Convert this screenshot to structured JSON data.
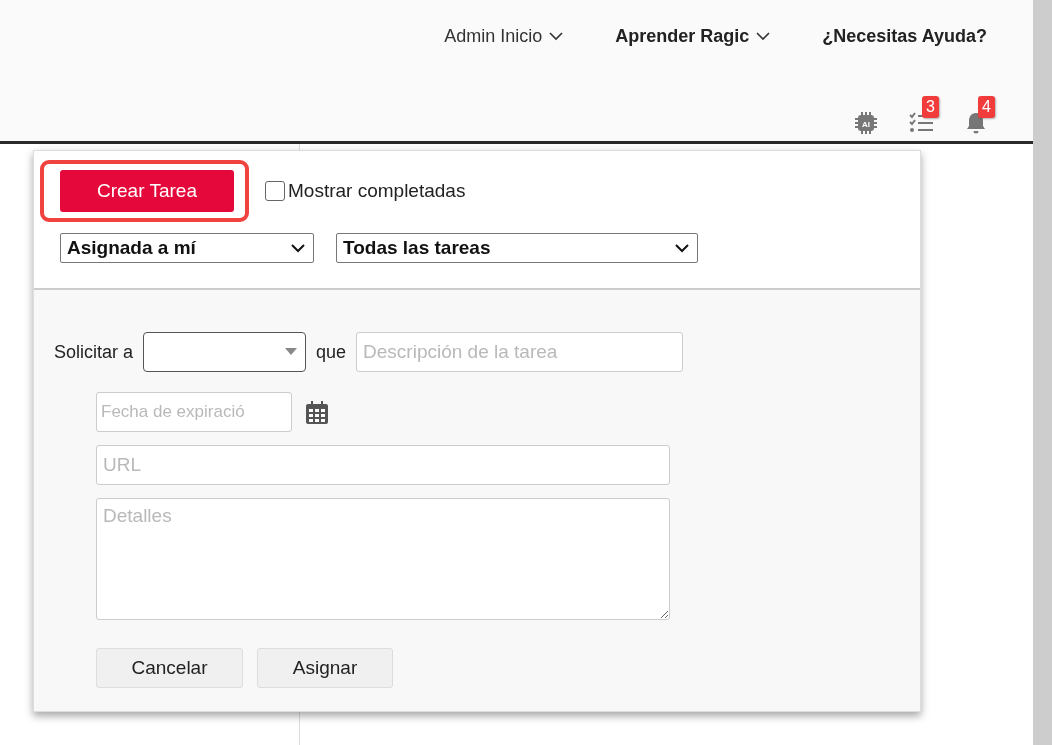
{
  "nav": [
    {
      "label": "Admin Inicio",
      "bold": false,
      "dropdown": true
    },
    {
      "label": "Aprender Ragic",
      "bold": true,
      "dropdown": true
    },
    {
      "label": "¿Necesitas Ayuda?",
      "bold": true,
      "dropdown": false
    }
  ],
  "toolbar_icons": [
    {
      "kind": "ai",
      "label": "AI"
    },
    {
      "kind": "tasks",
      "badge": "3"
    },
    {
      "kind": "bell",
      "badge": "4"
    }
  ],
  "task_panel": {
    "create_button": "Crear Tarea",
    "show_completed": {
      "label": "Mostrar completadas",
      "checked": false
    },
    "filters": [
      {
        "value": "Asignada a mí"
      },
      {
        "value": "Todas las tareas"
      }
    ],
    "form": {
      "request_label": "Solicitar a",
      "que_label": "que",
      "description": {
        "placeholder": "Descripción de la tarea"
      },
      "due_date": {
        "placeholder": "Fecha de expiració"
      },
      "url": {
        "placeholder": "URL"
      },
      "details": {
        "placeholder": "Detalles"
      }
    },
    "buttons": [
      "Cancelar",
      "Asignar"
    ]
  }
}
